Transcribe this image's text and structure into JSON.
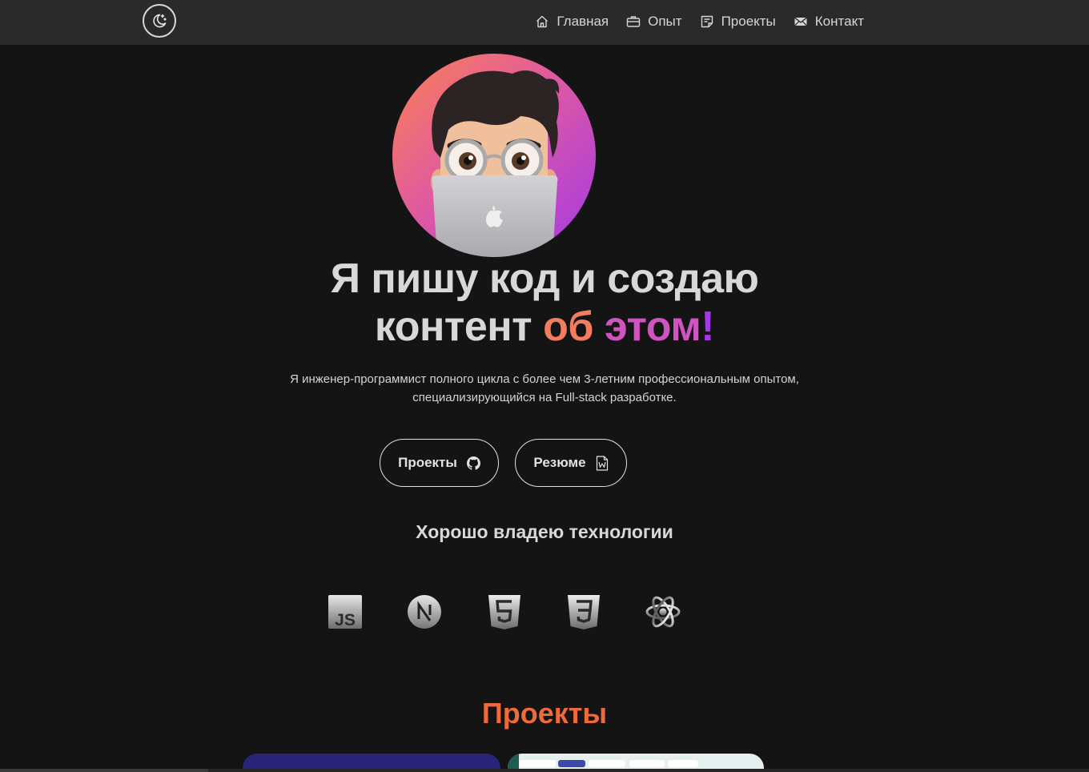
{
  "nav": {
    "items": [
      {
        "label": "Главная",
        "icon": "home-icon"
      },
      {
        "label": "Опыт",
        "icon": "briefcase-icon"
      },
      {
        "label": "Проекты",
        "icon": "note-icon"
      },
      {
        "label": "Контакт",
        "icon": "mail-icon"
      }
    ],
    "theme_icon": "moon-stars-icon"
  },
  "hero": {
    "title_line1": "Я пишу код и создаю",
    "title_line2_plain": "контент",
    "title_grad_a": "об",
    "title_grad_b": "этом",
    "title_grad_c": "!",
    "subtitle_line1": "Я инженер-программист полного цикла с более чем 3-летним профессиональным опытом,",
    "subtitle_line2": "специализирующийся на Full-stack разработке.",
    "buttons": [
      {
        "label": "Проекты",
        "icon": "github-icon"
      },
      {
        "label": "Резюме",
        "icon": "word-document-icon"
      }
    ]
  },
  "tech": {
    "title": "Хорошо владею технологии",
    "icons": [
      "javascript-icon",
      "nextjs-icon",
      "html5-icon",
      "css3-icon",
      "react-icon"
    ]
  },
  "projects": {
    "title": "Проекты"
  },
  "colors": {
    "background": "#141414",
    "navbar": "#2a2a2a",
    "accent_orange": "#ee6a3a",
    "gradient_start": "#f77d5a",
    "gradient_mid": "#e05aa0",
    "gradient_end": "#a338e8"
  }
}
